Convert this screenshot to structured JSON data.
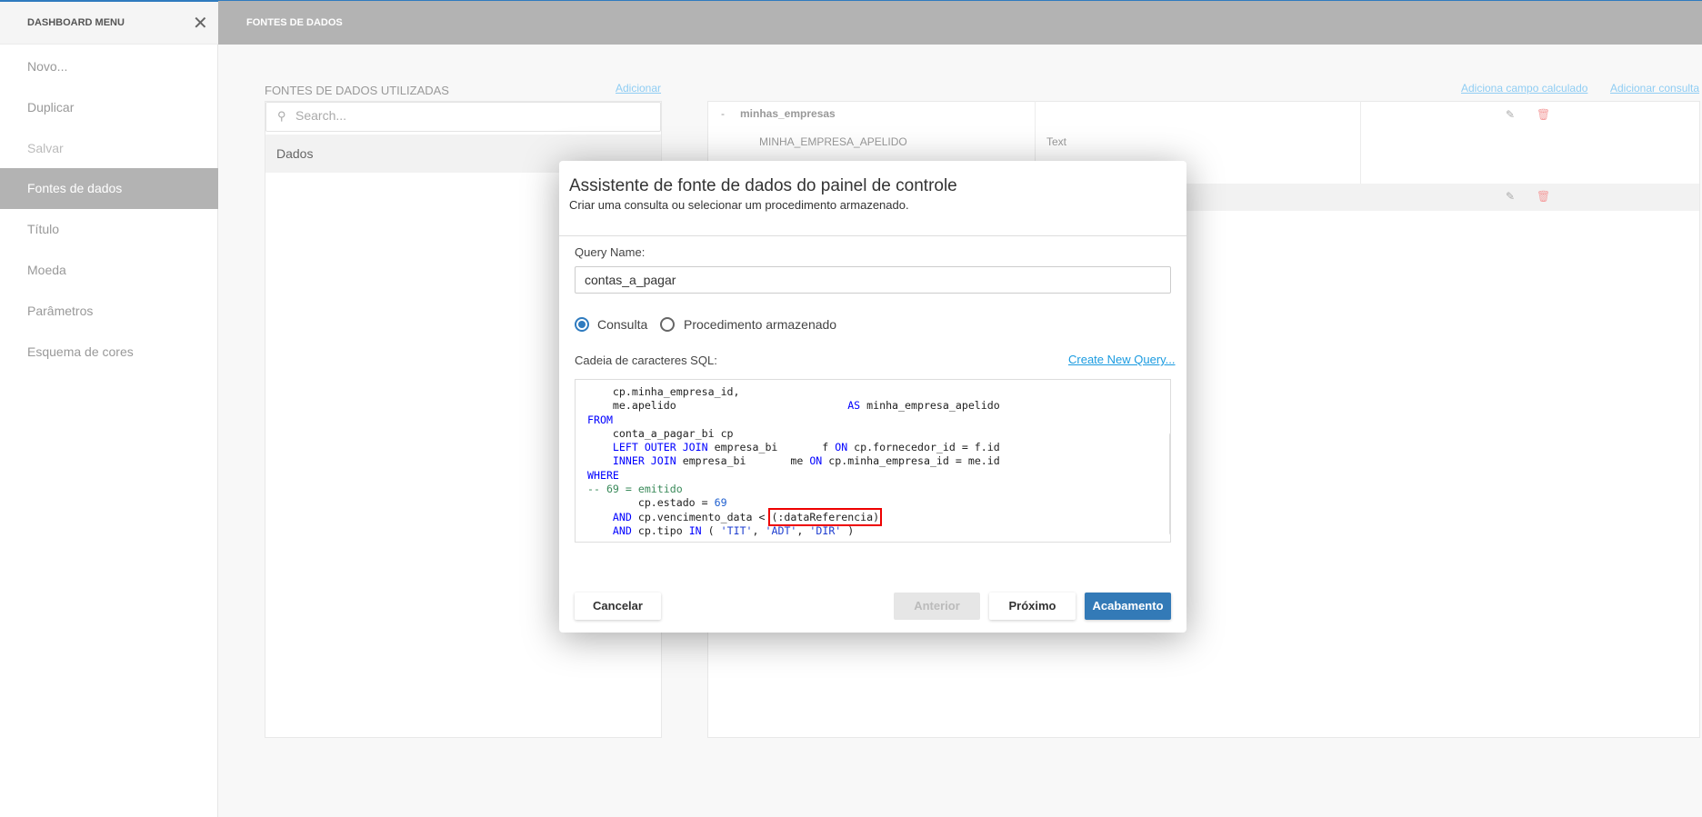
{
  "sidebar": {
    "title": "DASHBOARD MENU",
    "close_icon": "close-icon",
    "items": [
      {
        "label": "Novo..."
      },
      {
        "label": "Duplicar"
      },
      {
        "label": "Salvar"
      },
      {
        "label": "Fontes de dados"
      },
      {
        "label": "Título"
      },
      {
        "label": "Moeda"
      },
      {
        "label": "Parâmetros"
      },
      {
        "label": "Esquema de cores"
      }
    ],
    "active": "Fontes de dados"
  },
  "header": {
    "title": "FONTES DE DADOS"
  },
  "datasources": {
    "label": "FONTES DE DADOS UTILIZADAS",
    "add_link": "Adicionar",
    "search_placeholder": "Search...",
    "items": [
      "Dados"
    ]
  },
  "queries": {
    "add_calc_link": "Adiciona campo calculado",
    "add_query_link": "Adicionar consulta",
    "rows": [
      {
        "toggle": "-",
        "name": "minhas_empresas",
        "field": "MINHA_EMPRESA_APELIDO",
        "type": "Text"
      }
    ]
  },
  "modal": {
    "title": "Assistente de fonte de dados do painel de controle",
    "subtitle": "Criar uma consulta ou selecionar um procedimento armazenado.",
    "query_name_label": "Query Name:",
    "query_name_value": "contas_a_pagar",
    "radio_query": "Consulta",
    "radio_proc": "Procedimento armazenado",
    "selected": "Consulta",
    "sql_label": "Cadeia de caracteres SQL:",
    "create_link": "Create New Query...",
    "code": [
      [
        [
          "",
          "    cp.minha_empresa_id,"
        ]
      ],
      [
        [
          "",
          "    me.apelido                           "
        ],
        [
          "kw",
          "AS"
        ],
        [
          "",
          " minha_empresa_apelido"
        ]
      ],
      [
        [
          "kw",
          "FROM"
        ]
      ],
      [
        [
          "",
          "    conta_a_pagar_bi cp"
        ]
      ],
      [
        [
          "",
          "    "
        ],
        [
          "kw",
          "LEFT OUTER JOIN"
        ],
        [
          "",
          " empresa_bi       f "
        ],
        [
          "kw",
          "ON"
        ],
        [
          "",
          " cp.fornecedor_id = f.id"
        ]
      ],
      [
        [
          "",
          "    "
        ],
        [
          "kw",
          "INNER JOIN"
        ],
        [
          "",
          " empresa_bi       me "
        ],
        [
          "kw",
          "ON"
        ],
        [
          "",
          " cp.minha_empresa_id = me.id"
        ]
      ],
      [
        [
          "kw",
          "WHERE"
        ]
      ],
      [
        [
          "cm",
          "-- 69 = emitido"
        ]
      ],
      [
        [
          "",
          "        cp.estado = "
        ],
        [
          "num",
          "69"
        ]
      ],
      [
        [
          "",
          "    "
        ],
        [
          "kw",
          "AND"
        ],
        [
          "",
          " cp.vencimento_data < "
        ],
        [
          "hl",
          "(:dataReferencia)"
        ]
      ],
      [
        [
          "",
          "    "
        ],
        [
          "kw",
          "AND"
        ],
        [
          "",
          " cp.tipo "
        ],
        [
          "kw",
          "IN"
        ],
        [
          "",
          " ( "
        ],
        [
          "str",
          "'TIT'"
        ],
        [
          "",
          ", "
        ],
        [
          "str",
          "'ADT'"
        ],
        [
          "",
          ", "
        ],
        [
          "str",
          "'DIR'"
        ],
        [
          "",
          " )"
        ]
      ]
    ],
    "buttons": {
      "cancel": "Cancelar",
      "prev": "Anterior",
      "next": "Próximo",
      "finish": "Acabamento"
    }
  },
  "colors": {
    "accent": "#337ab7",
    "header": "#b3b3b3",
    "highlight_box": "#e00000"
  }
}
